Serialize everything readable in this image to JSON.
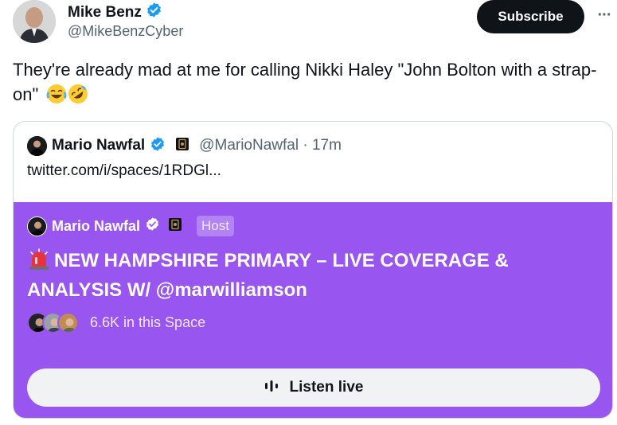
{
  "author": {
    "name": "Mike Benz",
    "handle": "@MikeBenzCyber",
    "verified": true
  },
  "actions": {
    "subscribe_label": "Subscribe",
    "more_label": "···"
  },
  "tweet": {
    "text": "They're already mad at me for calling Nikki Haley \"John Bolton with a strap-on\"",
    "emojis": [
      "joy-emoji",
      "rofl-emoji"
    ]
  },
  "quote": {
    "name": "Mario Nawfal",
    "handle_time": "@MarioNawfal · 17m",
    "text": "twitter.com/i/spaces/1RDGl..."
  },
  "space": {
    "host_name": "Mario Nawfal",
    "host_badge": "Host",
    "title": "NEW HAMPSHIRE PRIMARY – LIVE COVERAGE & ANALYSIS W/ @marwilliamson",
    "listeners": "6.6K in this Space",
    "listen_label": "Listen live"
  },
  "colors": {
    "accent_blue": "#1d9bf0",
    "space_purple": "#9855f0",
    "text_primary": "#0f1419",
    "text_secondary": "#536471"
  }
}
